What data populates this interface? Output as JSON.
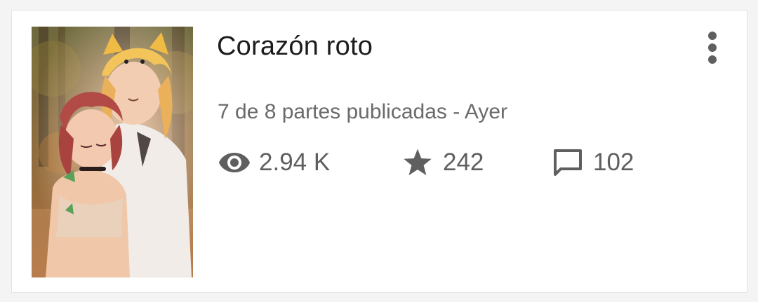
{
  "story": {
    "title": "Corazón roto",
    "meta": "7 de 8 partes publicadas - Ayer",
    "stats": {
      "reads": {
        "icon": "eye-icon",
        "value": "2.94 K"
      },
      "votes": {
        "icon": "star-icon",
        "value": "242"
      },
      "comments": {
        "icon": "comment-icon",
        "value": "102"
      }
    },
    "menu_icon": "more-vertical-icon"
  },
  "colors": {
    "title": "#1c1c1c",
    "secondary": "#6a6a6a",
    "icon": "#5f5f5f",
    "card_bg": "#ffffff"
  }
}
